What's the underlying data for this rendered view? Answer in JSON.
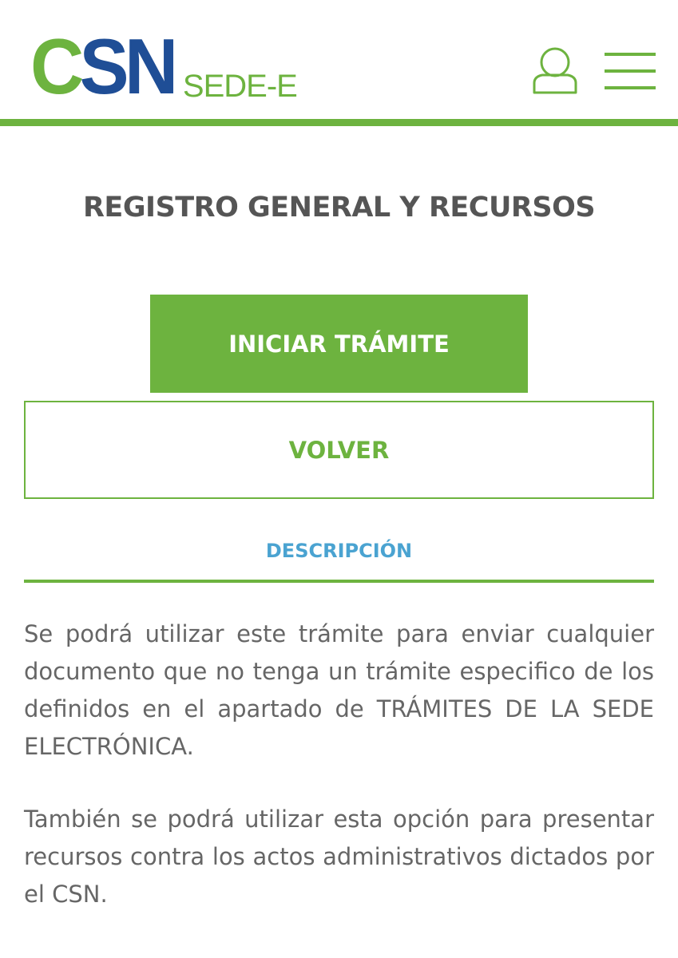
{
  "header": {
    "logo_c": "C",
    "logo_sn": "SN",
    "logo_sede": "SEDE-E",
    "user_icon": "user-icon",
    "menu_icon": "hamburger-menu-icon"
  },
  "main": {
    "title": "REGISTRO GENERAL Y RECURSOS",
    "start_button_label": "INICIAR TRÁMITE",
    "back_button_label": "VOLVER",
    "tab_label": "DESCRIPCIÓN",
    "paragraphs": [
      "Se podrá utilizar este trámite para enviar cualquier documento que no tenga un trámite especifico de los definidos en el apartado de TRÁMITES DE LA SEDE ELECTRÓNICA.",
      "También se podrá utilizar esta opción para presentar recursos contra los actos administrativos dictados por el CSN."
    ]
  },
  "colors": {
    "brand_green": "#6db33f",
    "brand_blue": "#1f4e96",
    "tab_blue": "#4aa3d1",
    "title_gray": "#555555",
    "text_gray": "#666666"
  }
}
